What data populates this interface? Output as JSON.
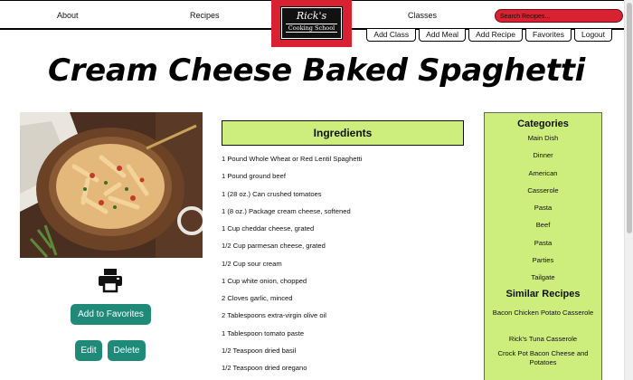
{
  "nav": {
    "about": "About",
    "recipes": "Recipes",
    "classes": "Classes"
  },
  "logo": {
    "title": "Rick's",
    "subtitle": "Cooking School"
  },
  "search": {
    "placeholder": "Search Recipes..."
  },
  "user_tabs": [
    "Add Class",
    "Add Meal",
    "Add Recipe",
    "Favorites",
    "Logout"
  ],
  "recipe": {
    "title": "Cream Cheese Baked Spaghetti"
  },
  "actions": {
    "add_favorites": "Add to Favorites",
    "edit": "Edit",
    "delete": "Delete"
  },
  "ingredients": {
    "header": "Ingredients",
    "items": [
      "1 Pound Whole Wheat or Red Lentil Spaghetti",
      "1 Pound ground beef",
      "1 (28 oz.) Can crushed tomatoes",
      "1 (8 oz.) Package cream cheese, softened",
      "1 Cup cheddar cheese, grated",
      "1/2 Cup parmesan cheese, grated",
      "1/2 Cup sour cream",
      "1 Cup white onion, chopped",
      "2 Cloves garlic, minced",
      "2 Tablespoons extra-virgin olive oil",
      "1 Tablespoon tomato paste",
      "1/2 Teaspoon dried basil",
      "1/2 Teaspoon dried oregano"
    ]
  },
  "sidebar": {
    "categories_header": "Categories",
    "categories": [
      "Main Dish",
      "Dinner",
      "American",
      "Casserole",
      "Pasta",
      "Beef",
      "Pasta",
      "Parties",
      "Tailgate"
    ],
    "similar_header": "Similar Recipes",
    "similar": [
      "Bacon Chicken Potato Casserole",
      "Rick's Tuna Casserole",
      "Crock Pot Bacon Cheese and Potatoes"
    ]
  },
  "colors": {
    "accent_green": "#cdee7c",
    "button_teal": "#1f8a78",
    "brand_red": "#d82232"
  }
}
